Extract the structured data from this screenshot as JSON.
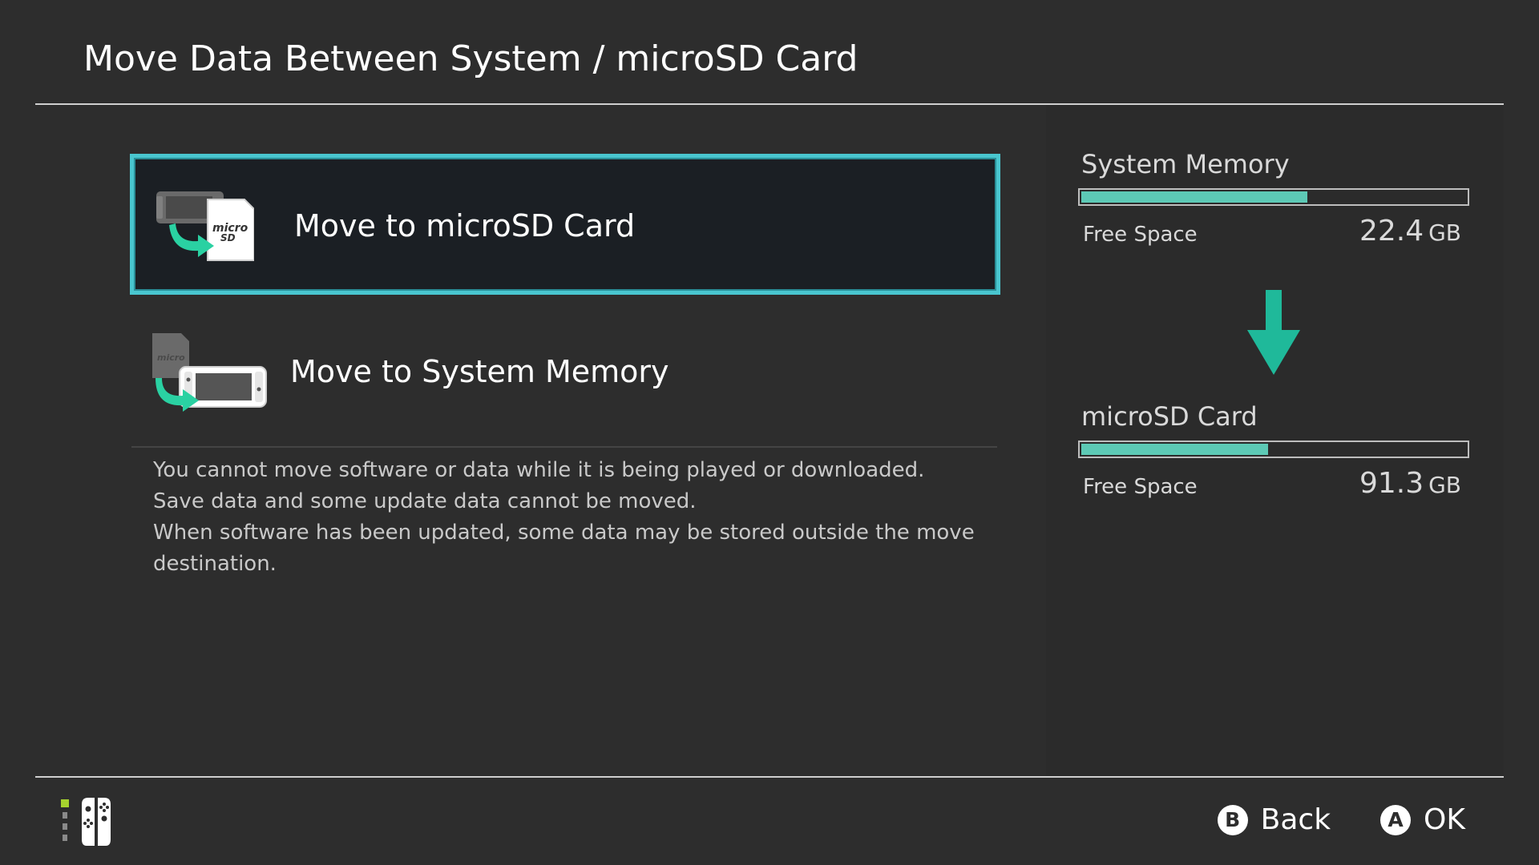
{
  "header": {
    "title": "Move Data Between System / microSD Card"
  },
  "options": [
    {
      "label": "Move to microSD Card",
      "selected": true,
      "icon": "move-to-microsd-icon"
    },
    {
      "label": "Move to System Memory",
      "selected": false,
      "icon": "move-to-system-icon"
    }
  ],
  "notes": [
    "You cannot move software or data while it is being played or downloaded.",
    "Save data and some update data cannot be moved.",
    "When software has been updated, some data may be stored outside the move",
    "destination."
  ],
  "storage": {
    "system": {
      "name": "System Memory",
      "free_label": "Free Space",
      "free_value": "22.4",
      "unit": "GB",
      "usage_fraction": 0.59
    },
    "microsd": {
      "name": "microSD Card",
      "free_label": "Free Space",
      "free_value": "91.3",
      "unit": "GB",
      "usage_fraction": 0.49
    }
  },
  "footer": {
    "back": {
      "key": "B",
      "label": "Back"
    },
    "ok": {
      "key": "A",
      "label": "OK"
    }
  },
  "colors": {
    "accent": "#49c6cf",
    "bar_fill": "#5dc9b5",
    "arrow": "#1fb99a",
    "player_indicator": "#a6d22e"
  }
}
